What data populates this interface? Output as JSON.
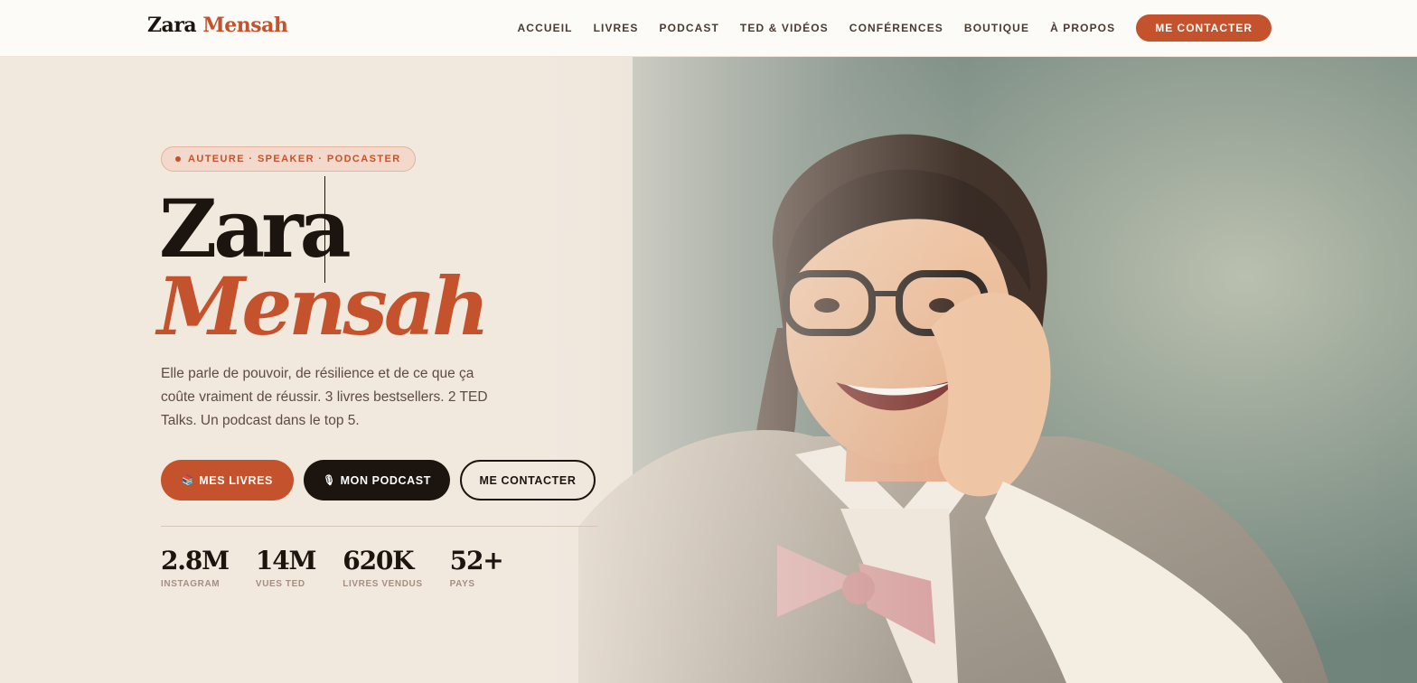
{
  "brand": {
    "first": "Zara",
    "last": "Mensah"
  },
  "nav": {
    "links": [
      "ACCUEIL",
      "LIVRES",
      "PODCAST",
      "TED & VIDÉOS",
      "CONFÉRENCES",
      "BOUTIQUE",
      "À PROPOS"
    ],
    "cta": "ME CONTACTER"
  },
  "hero": {
    "tagline": "AUTEURE · SPEAKER · PODCASTER",
    "name_first": "Zara",
    "name_last": "Mensah",
    "lede": "Elle parle de pouvoir, de résilience et de ce que ça coûte vraiment de réussir. 3 livres bestsellers. 2 TED Talks. Un podcast dans le top 5.",
    "buttons": {
      "books": {
        "icon": "📚",
        "label": "MES LIVRES"
      },
      "podcast": {
        "icon": "🎙",
        "label": "MON PODCAST"
      },
      "contact": {
        "label": "ME CONTACTER"
      }
    },
    "stats": [
      {
        "value": "2.8M",
        "label": "INSTAGRAM"
      },
      {
        "value": "14M",
        "label": "VUES TED"
      },
      {
        "value": "620K",
        "label": "LIVRES VENDUS"
      },
      {
        "value": "52+",
        "label": "PAYS"
      }
    ]
  },
  "colors": {
    "accent": "#c4532d",
    "ink": "#1c140f",
    "cream": "#f1e8de",
    "header_bg": "#fdfbf8"
  }
}
